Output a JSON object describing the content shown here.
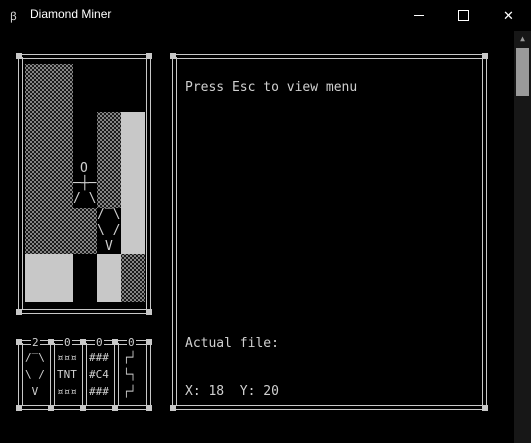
{
  "window": {
    "title": "Diamond Miner",
    "minimize_symbol": "—",
    "maximize_symbol": "☐",
    "close_symbol": "✕",
    "icon": "app-icon"
  },
  "game": {
    "player_head": "O",
    "player_body": "─┼─",
    "player_legs": "/ \\",
    "diamond_lines": [
      "/‾\\",
      "\\ /",
      "V"
    ]
  },
  "inventory": {
    "counts": [
      "2",
      "0",
      "0",
      "0"
    ],
    "diamond": [
      "/‾\\",
      "\\ /",
      " V "
    ],
    "tnt": [
      "¤¤¤",
      "TNT",
      "¤¤¤"
    ],
    "c4": [
      "###",
      "#C4",
      "###"
    ],
    "ladder": [
      "┌┘",
      "└┐",
      "┌┘"
    ]
  },
  "info": {
    "hint": "Press Esc to view menu",
    "file_label": "Actual file:",
    "coords": "X: 18  Y: 20"
  }
}
